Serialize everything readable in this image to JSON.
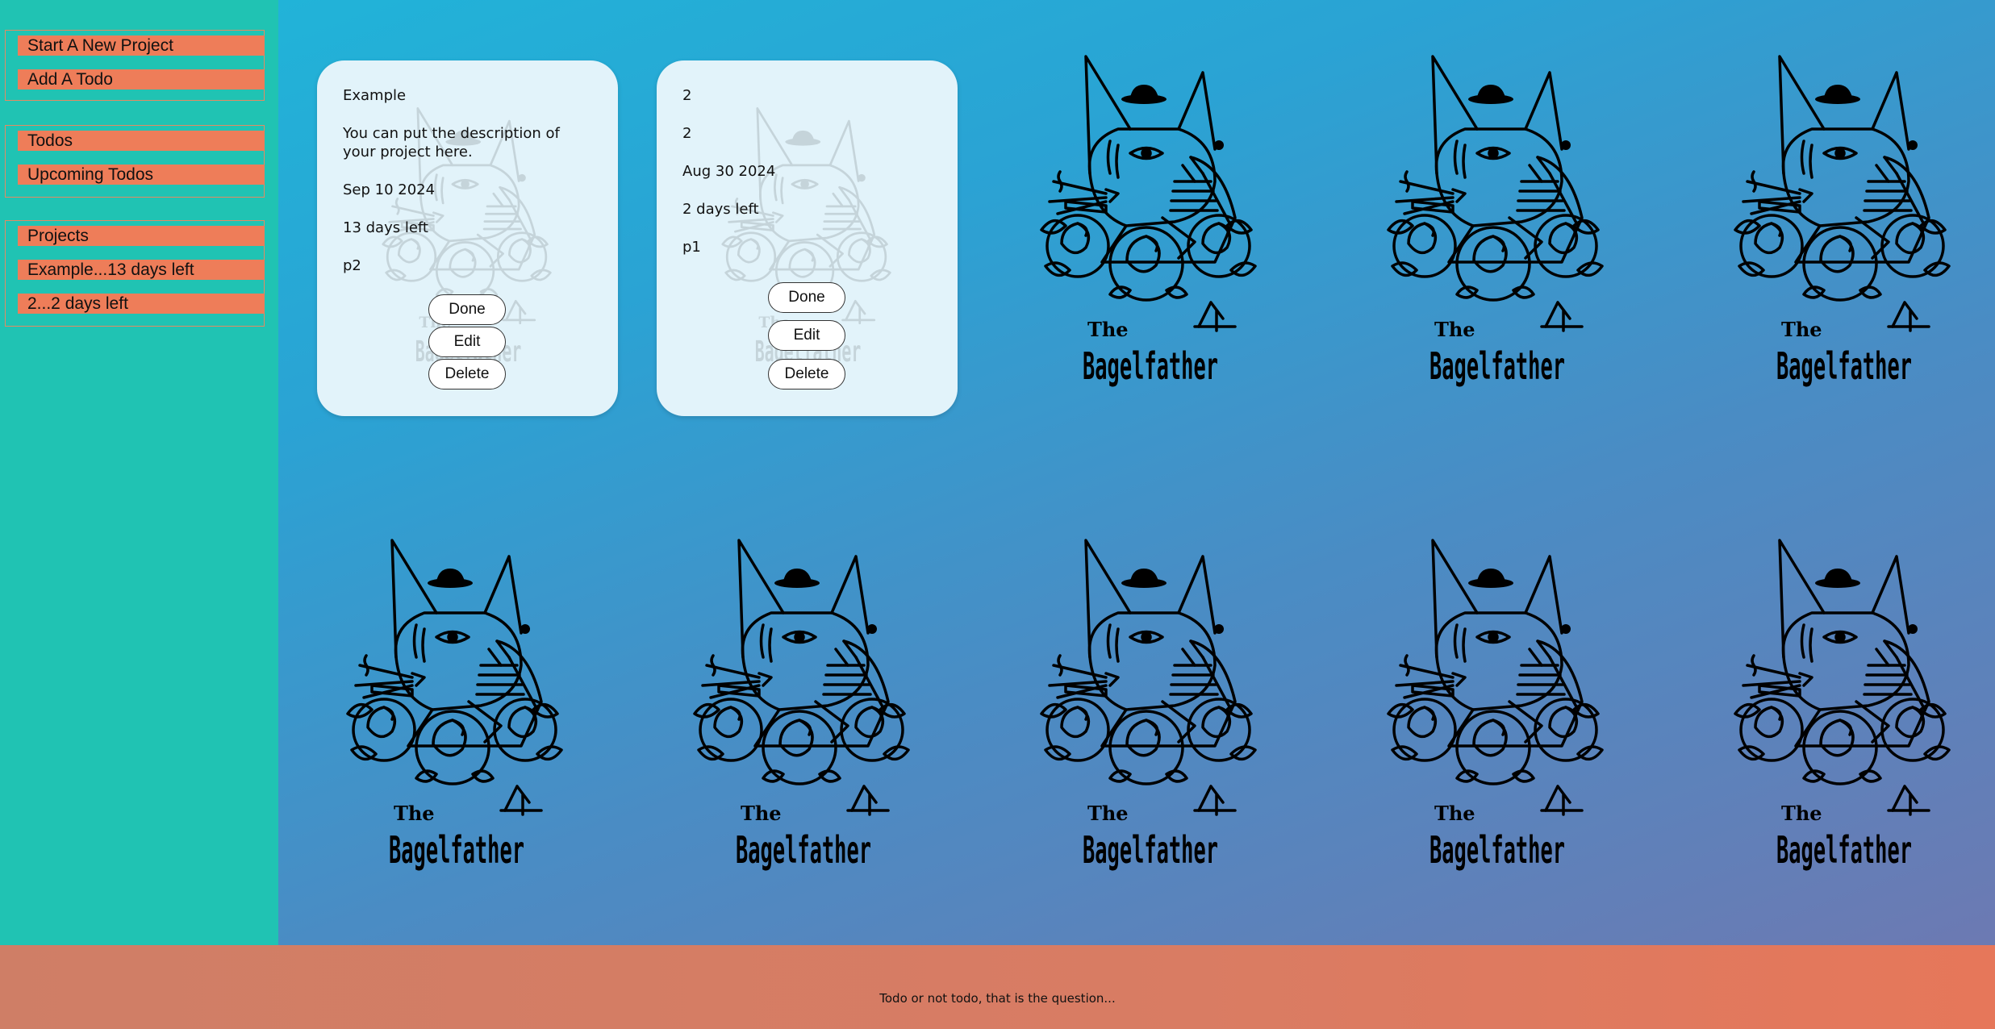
{
  "sidebar": {
    "actions": [
      "Start A New Project",
      "Add A Todo"
    ],
    "todos": [
      "Todos",
      "Upcoming Todos"
    ],
    "projects_header": "Projects",
    "projects": [
      "Example...13 days left",
      "2...2 days left"
    ]
  },
  "cards": [
    {
      "title": "Example",
      "description": "You can put the description of your project here.",
      "due_date": "Sep 10 2024",
      "remaining": "13 days left",
      "priority": "p2",
      "done_label": "Done",
      "edit_label": "Edit",
      "delete_label": "Delete"
    },
    {
      "title": "2",
      "description": "2",
      "due_date": "Aug 30 2024",
      "remaining": "2 days left",
      "priority": "p1",
      "done_label": "Done",
      "edit_label": "Edit",
      "delete_label": "Delete"
    }
  ],
  "artwork": {
    "name": "The Bagelfather",
    "count": 8
  },
  "footer": {
    "text": "Todo or not todo, that is the question..."
  }
}
